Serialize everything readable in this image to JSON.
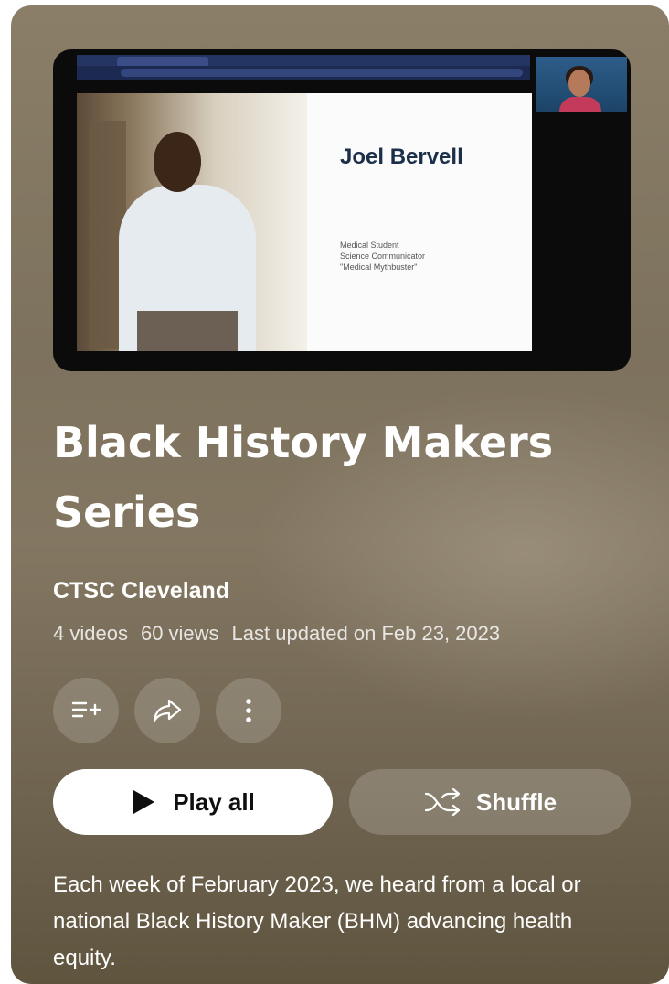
{
  "playlist": {
    "title": "Black History Makers Series",
    "channel": "CTSC Cleveland",
    "video_count": "4 videos",
    "views": "60 views",
    "last_updated": "Last updated on Feb 23, 2023",
    "description": "Each week of February 2023, we heard from a local or national Black History Maker (BHM) advancing health equity."
  },
  "thumbnail": {
    "slide_name": "Joel Bervell",
    "slide_lines": [
      "Medical Student",
      "Science Communicator",
      "\"Medical Mythbuster\""
    ]
  },
  "actions": {
    "play_all_label": "Play all",
    "shuffle_label": "Shuffle",
    "icons": [
      "add-to-queue-icon",
      "share-icon",
      "more-vert-icon"
    ]
  },
  "colors": {
    "card_background": "#7d725d",
    "play_all_background": "#ffffff",
    "text_primary": "#ffffff"
  }
}
